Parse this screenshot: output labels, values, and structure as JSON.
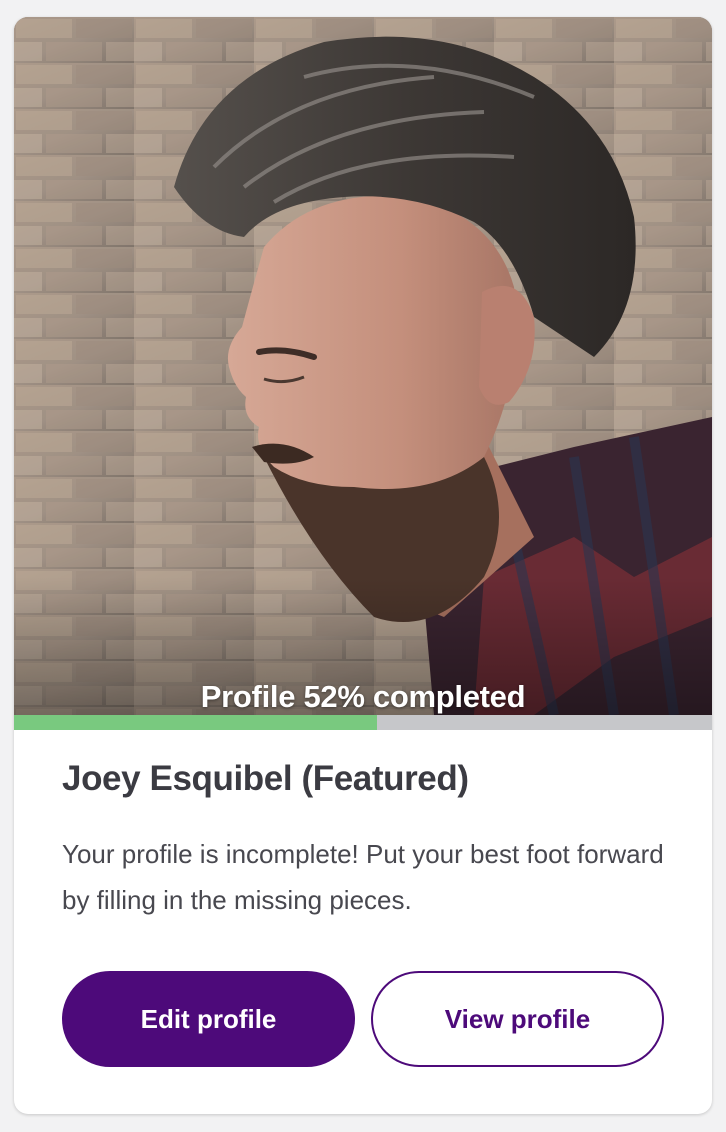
{
  "profile": {
    "photo_alt": "Profile photo",
    "completion_label": "Profile 52% completed",
    "completion_fraction": 0.52,
    "name": "Joey Esquibel (Featured)",
    "description": "Your profile is incomplete! Put your best foot forward by filling in the missing pieces."
  },
  "actions": {
    "edit_label": "Edit profile",
    "view_label": "View profile"
  },
  "colors": {
    "progress_fill": "#79c97f",
    "progress_track": "#c6c7ca",
    "brand_purple": "#4d0a7a",
    "page_background": "#f2f2f3"
  }
}
